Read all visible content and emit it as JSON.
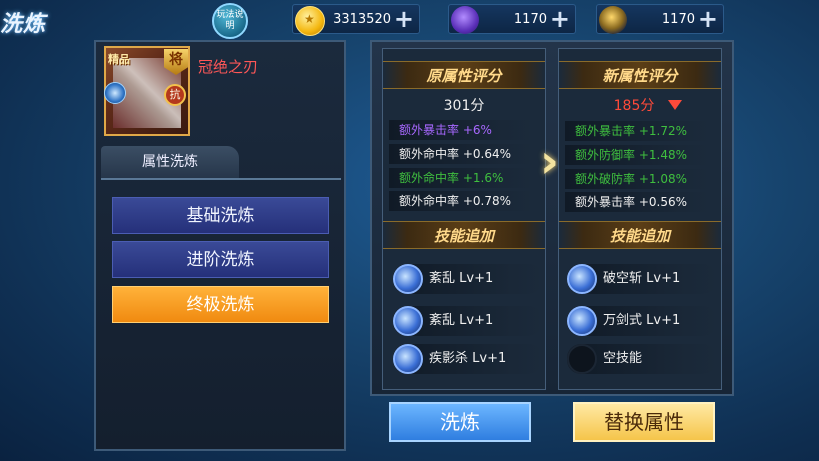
{
  "header": {
    "title": "洗炼",
    "help_label": "玩法说明"
  },
  "resources": [
    {
      "icon": "gold-coin-icon",
      "value": "3313520"
    },
    {
      "icon": "purple-bag-icon",
      "value": "1170"
    },
    {
      "icon": "gem-bag-icon",
      "value": "1170"
    }
  ],
  "item": {
    "quality": "精品",
    "rank_badge": "将",
    "resist_badge": "抗",
    "name": "冠绝之刃"
  },
  "tab": {
    "label": "属性洗炼"
  },
  "options": [
    {
      "label": "基础洗炼",
      "active": false
    },
    {
      "label": "进阶洗炼",
      "active": false
    },
    {
      "label": "终极洗炼",
      "active": true
    }
  ],
  "original": {
    "header": "原属性评分",
    "score": "301分",
    "stats": [
      {
        "text": "额外暴击率 +6%",
        "color": "purple"
      },
      {
        "text": "额外命中率 +0.64%",
        "color": "white"
      },
      {
        "text": "额外命中率 +1.6%",
        "color": "green"
      },
      {
        "text": "额外命中率 +0.78%",
        "color": "white"
      }
    ],
    "skills_header": "技能追加",
    "skills": [
      {
        "name": "紊乱 Lv+1"
      },
      {
        "name": "紊乱 Lv+1"
      },
      {
        "name": "疾影杀 Lv+1"
      }
    ]
  },
  "new": {
    "header": "新属性评分",
    "score": "185分",
    "stats": [
      {
        "text": "额外暴击率 +1.72%",
        "color": "green"
      },
      {
        "text": "额外防御率 +1.48%",
        "color": "green"
      },
      {
        "text": "额外破防率 +1.08%",
        "color": "green"
      },
      {
        "text": "额外暴击率 +0.56%",
        "color": "white"
      }
    ],
    "skills_header": "技能追加",
    "skills": [
      {
        "name": "破空斩 Lv+1"
      },
      {
        "name": "万剑式 Lv+1"
      },
      {
        "name": "空技能"
      }
    ]
  },
  "actions": {
    "refine": "洗炼",
    "replace": "替换属性"
  },
  "colors": {
    "accent_orange": "#f08a10",
    "score_down": "#ff4a3a",
    "stat_green": "#3fbf3f",
    "stat_purple": "#a868ff"
  }
}
